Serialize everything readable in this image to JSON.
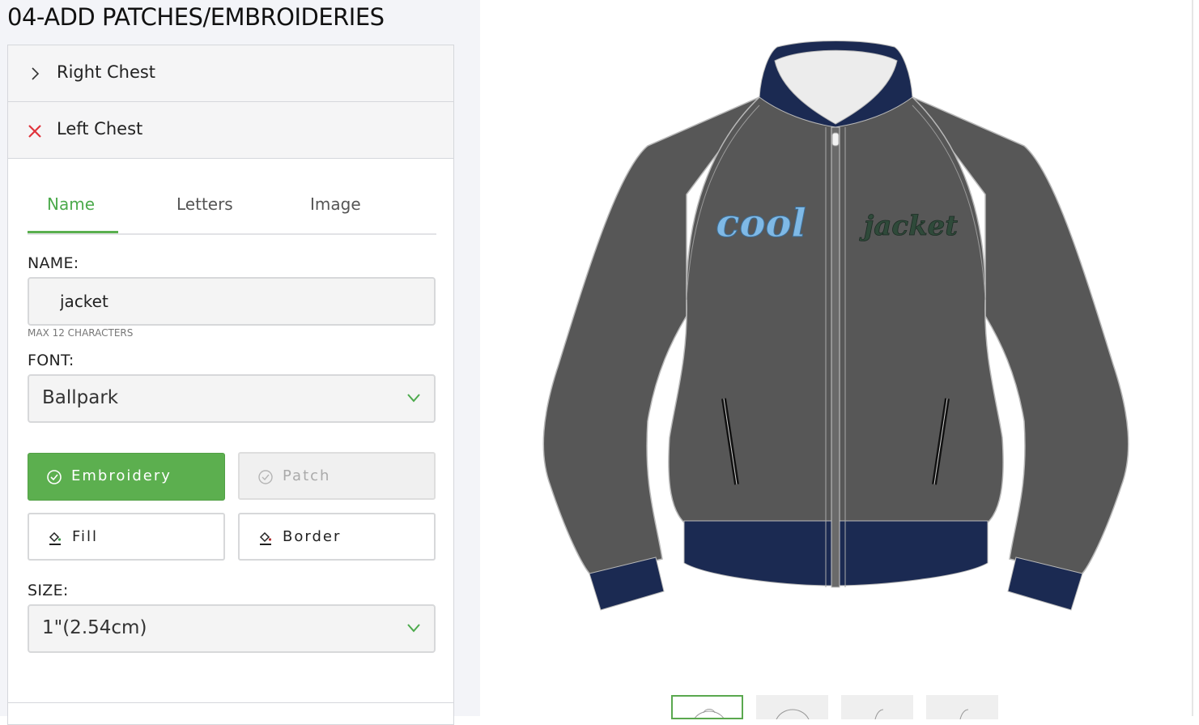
{
  "section": {
    "title": "04-ADD PATCHES/EMBROIDERIES"
  },
  "accordion": {
    "items": [
      {
        "label": "Right Chest",
        "icon": "chevron-right-icon",
        "state": "collapsed"
      },
      {
        "label": "Left Chest",
        "icon": "close-icon",
        "state": "expanded"
      }
    ]
  },
  "tabs": [
    {
      "label": "Name",
      "active": true
    },
    {
      "label": "Letters",
      "active": false
    },
    {
      "label": "Image",
      "active": false
    }
  ],
  "form": {
    "name_label": "NAME:",
    "name_value": "jacket",
    "name_hint": "MAX 12 CHARACTERS",
    "font_label": "FONT:",
    "font_value": "Ballpark",
    "size_label": "SIZE:",
    "size_value": "1\"(2.54cm)"
  },
  "type_buttons": {
    "embroidery": "Embroidery",
    "patch": "Patch",
    "selected": "Embroidery"
  },
  "color_buttons": {
    "fill": "Fill",
    "border": "Border"
  },
  "preview": {
    "left_text": "cool",
    "right_text": "jacket",
    "colors": {
      "body": "#575757",
      "trim": "#1b2a52",
      "left_text": "#7fb9e6",
      "right_text": "#2f4a3a"
    }
  },
  "thumbnails": {
    "count": 4,
    "active_index": 0,
    "icons": [
      "jacket-front-thumb-icon",
      "jacket-back-thumb-icon",
      "jacket-left-sleeve-thumb-icon",
      "jacket-right-sleeve-thumb-icon"
    ]
  },
  "colors": {
    "accent": "#5caf4f",
    "close": "#e0333c",
    "panel_bg": "#f3f4f8"
  }
}
